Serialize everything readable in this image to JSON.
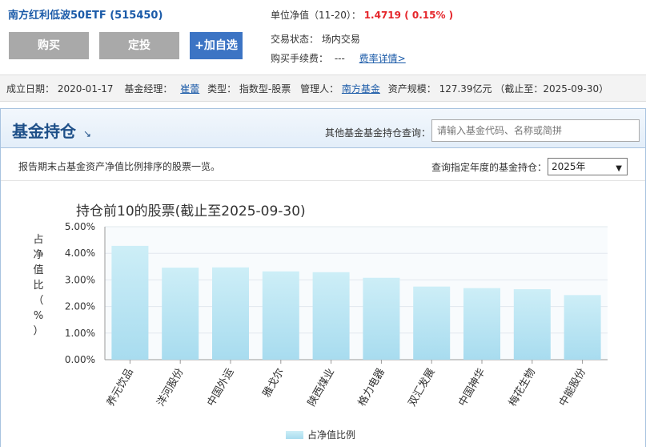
{
  "header": {
    "fund_title": "南方红利低波50ETF (515450)",
    "buy_label": "购买",
    "fixed_label": "定投",
    "watch_label": "+加自选",
    "nav_label": "单位净值（11-20）：",
    "nav_value": "1.4719 ( 0.15% )",
    "trade_status": "交易状态：  场内交易",
    "fee_label": "购买手续费：",
    "fee_value": "---",
    "fee_link": "费率详情>"
  },
  "info": {
    "established": "成立日期：  2020-01-17",
    "manager_label": "基金经理：",
    "manager": "崔蕾",
    "type": "类型：  指数型-股票",
    "admin_label": "管理人：",
    "admin": "南方基金",
    "scale": "资产规模：  127.39亿元 （截止至：2025-09-30）"
  },
  "holdings": {
    "title": "基金持仓",
    "query_label": "其他基金基金持仓查询：",
    "query_placeholder": "请输入基金代码、名称或简拼",
    "description": "报告期末占基金资产净值比例排序的股票一览。",
    "year_label": "查询指定年度的基金持仓：",
    "year_value": "2025年"
  },
  "colors": {
    "bar_top": "#cdeef7",
    "bar_bottom": "#a8dcef",
    "accent": "#e5262b",
    "title_blue": "#1d4f88"
  },
  "chart_data": {
    "type": "bar",
    "title": "持仓前10的股票(截止至2025-09-30)",
    "ylabel": "占净值比（%）",
    "categories": [
      "养元饮品",
      "洋河股份",
      "中国外运",
      "雅戈尔",
      "陕西煤业",
      "格力电器",
      "双汇发展",
      "中国神华",
      "梅花生物",
      "中能股份"
    ],
    "values": [
      4.28,
      3.46,
      3.47,
      3.32,
      3.29,
      3.08,
      2.75,
      2.69,
      2.65,
      2.43
    ],
    "ylim": [
      0,
      5
    ],
    "yticks": [
      "0.00%",
      "1.00%",
      "2.00%",
      "3.00%",
      "4.00%",
      "5.00%"
    ],
    "legend": [
      "占净值比例"
    ],
    "legend_position": "bottom",
    "grid": true
  }
}
